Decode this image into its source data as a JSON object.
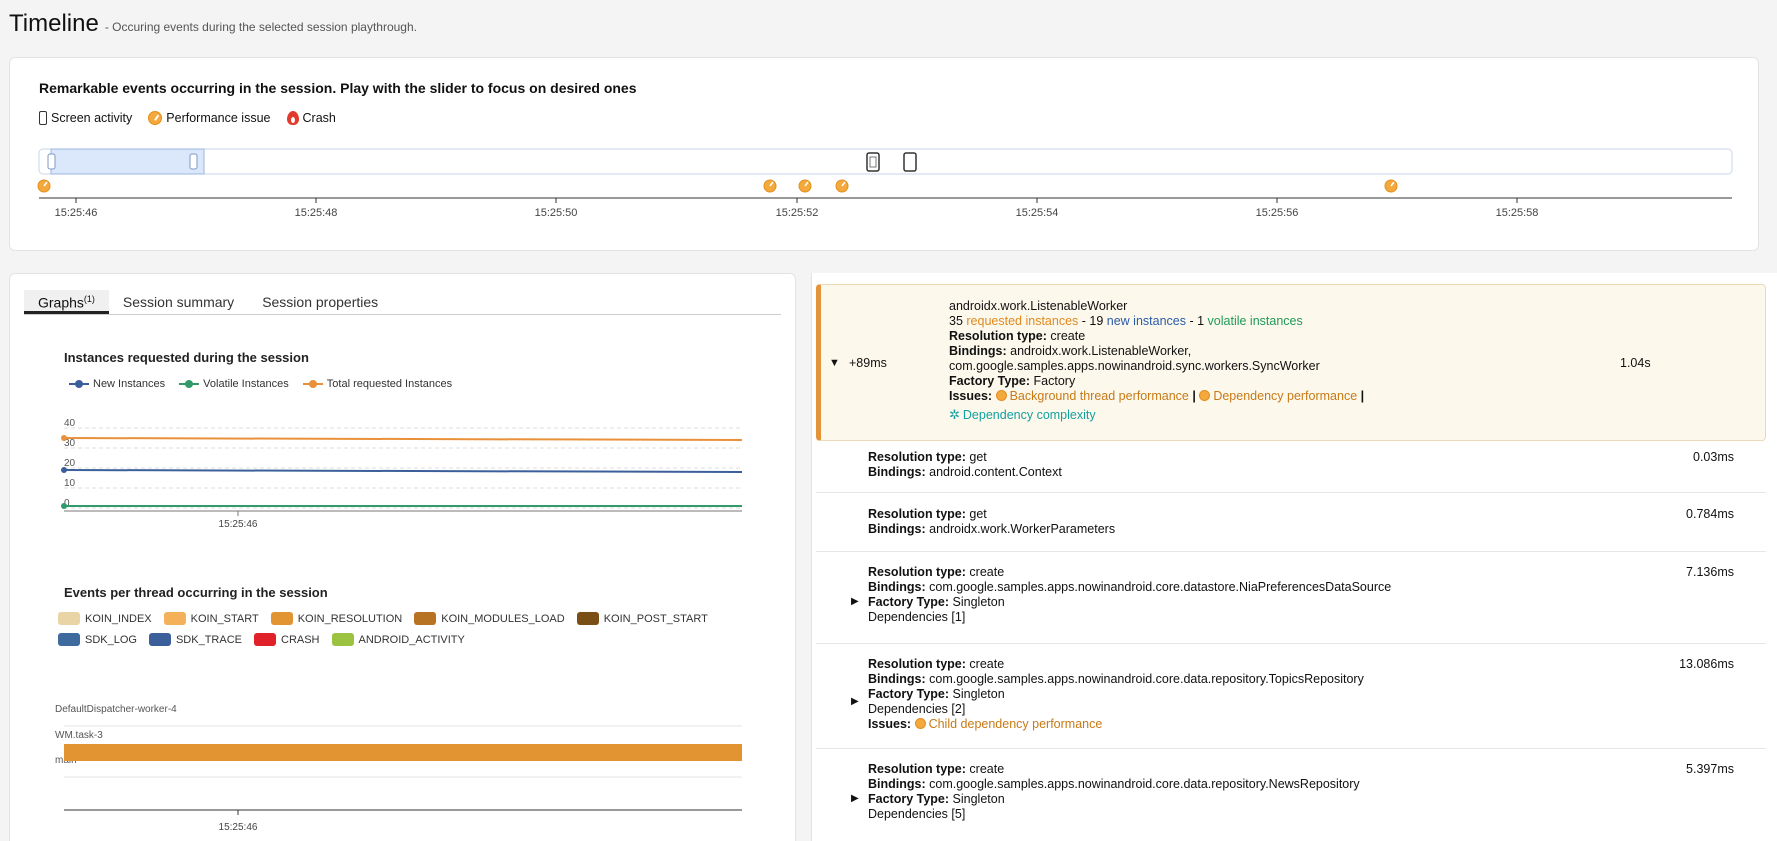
{
  "header": {
    "title": "Timeline",
    "subtitle": "- Occuring events during the selected session playthrough."
  },
  "timeline": {
    "heading": "Remarkable events occurring in the session. Play with the slider to focus on desired ones",
    "legend": [
      {
        "label": "Screen activity",
        "icon": "phone-icon"
      },
      {
        "label": "Performance issue",
        "icon": "speedometer-icon"
      },
      {
        "label": "Crash",
        "icon": "flame-icon"
      }
    ],
    "ticks": [
      "15:25:46",
      "15:25:48",
      "15:25:50",
      "15:25:52",
      "15:25:54",
      "15:25:56",
      "15:25:58"
    ]
  },
  "tabs": [
    {
      "label": "Graphs",
      "badge": "(1)",
      "active": true
    },
    {
      "label": "Session summary",
      "active": false
    },
    {
      "label": "Session properties",
      "active": false
    }
  ],
  "chart_data": [
    {
      "type": "line",
      "title": "Instances requested during the session",
      "xlabel": "",
      "ylabel": "",
      "x_tick": "15:25:46",
      "y_ticks": [
        0,
        10,
        20,
        30,
        40
      ],
      "ylim": [
        0,
        40
      ],
      "grid": true,
      "legend_position": "top-left",
      "series": [
        {
          "name": "New Instances",
          "color": "#3b5f9a",
          "start": 19,
          "end": 18
        },
        {
          "name": "Volatile Instances",
          "color": "#2f9a6a",
          "start": 1,
          "end": 1
        },
        {
          "name": "Total requested Instances",
          "color": "#e9913a",
          "start": 35,
          "end": 34
        }
      ]
    },
    {
      "type": "bar",
      "title": "Events per thread occurring in the session",
      "categories": [
        "DefaultDispatcher-worker-4",
        "WM.task-3",
        "main"
      ],
      "x_tick": "15:25:46",
      "legend": [
        {
          "name": "KOIN_INDEX",
          "color": "#e8d4a4"
        },
        {
          "name": "KOIN_START",
          "color": "#f5b05a"
        },
        {
          "name": "KOIN_RESOLUTION",
          "color": "#e29433"
        },
        {
          "name": "KOIN_MODULES_LOAD",
          "color": "#b87322"
        },
        {
          "name": "KOIN_POST_START",
          "color": "#7a4f16"
        },
        {
          "name": "SDK_LOG",
          "color": "#3e6a9e"
        },
        {
          "name": "SDK_TRACE",
          "color": "#3b5f9a"
        },
        {
          "name": "CRASH",
          "color": "#e0212a"
        },
        {
          "name": "ANDROID_ACTIVITY",
          "color": "#9cc242"
        }
      ],
      "bars": [
        {
          "thread": "WM.task-3",
          "event": "KOIN_RESOLUTION"
        }
      ]
    }
  ],
  "details": {
    "main": {
      "delta": "+89ms",
      "title": "androidx.work.ListenableWorker",
      "requested_count": "35",
      "requested_label": "requested instances",
      "new_count": "19",
      "new_label": "new instances",
      "volatile_count": "1",
      "volatile_label": "volatile instances",
      "resolution_label": "Resolution type:",
      "resolution": "create",
      "bindings_label": "Bindings:",
      "bindings_1": "androidx.work.ListenableWorker,",
      "bindings_2": "com.google.samples.apps.nowinandroid.sync.workers.SyncWorker",
      "factory_label": "Factory Type:",
      "factory": "Factory",
      "issues_label": "Issues:",
      "issue_1": "Background thread performance",
      "issue_2": "Dependency performance",
      "issue_3": "Dependency complexity",
      "time": "1.04s"
    },
    "rows": [
      {
        "resolution": "get",
        "bindings": "android.content.Context",
        "time": "0.03ms"
      },
      {
        "resolution": "get",
        "bindings": "androidx.work.WorkerParameters",
        "time": "0.784ms"
      },
      {
        "resolution": "create",
        "bindings": "com.google.samples.apps.nowinandroid.core.datastore.NiaPreferencesDataSource",
        "factory": "Singleton",
        "deps": "Dependencies [1]",
        "time": "7.136ms"
      },
      {
        "resolution": "create",
        "bindings": "com.google.samples.apps.nowinandroid.core.data.repository.TopicsRepository",
        "factory": "Singleton",
        "deps": "Dependencies [2]",
        "issue": "Child dependency performance",
        "time": "13.086ms"
      },
      {
        "resolution": "create",
        "bindings": "com.google.samples.apps.nowinandroid.core.data.repository.NewsRepository",
        "factory": "Singleton",
        "deps": "Dependencies [5]",
        "time": "5.397ms"
      }
    ],
    "labels": {
      "resolution": "Resolution type:",
      "bindings": "Bindings:",
      "factory": "Factory Type:",
      "issues": "Issues:"
    }
  }
}
